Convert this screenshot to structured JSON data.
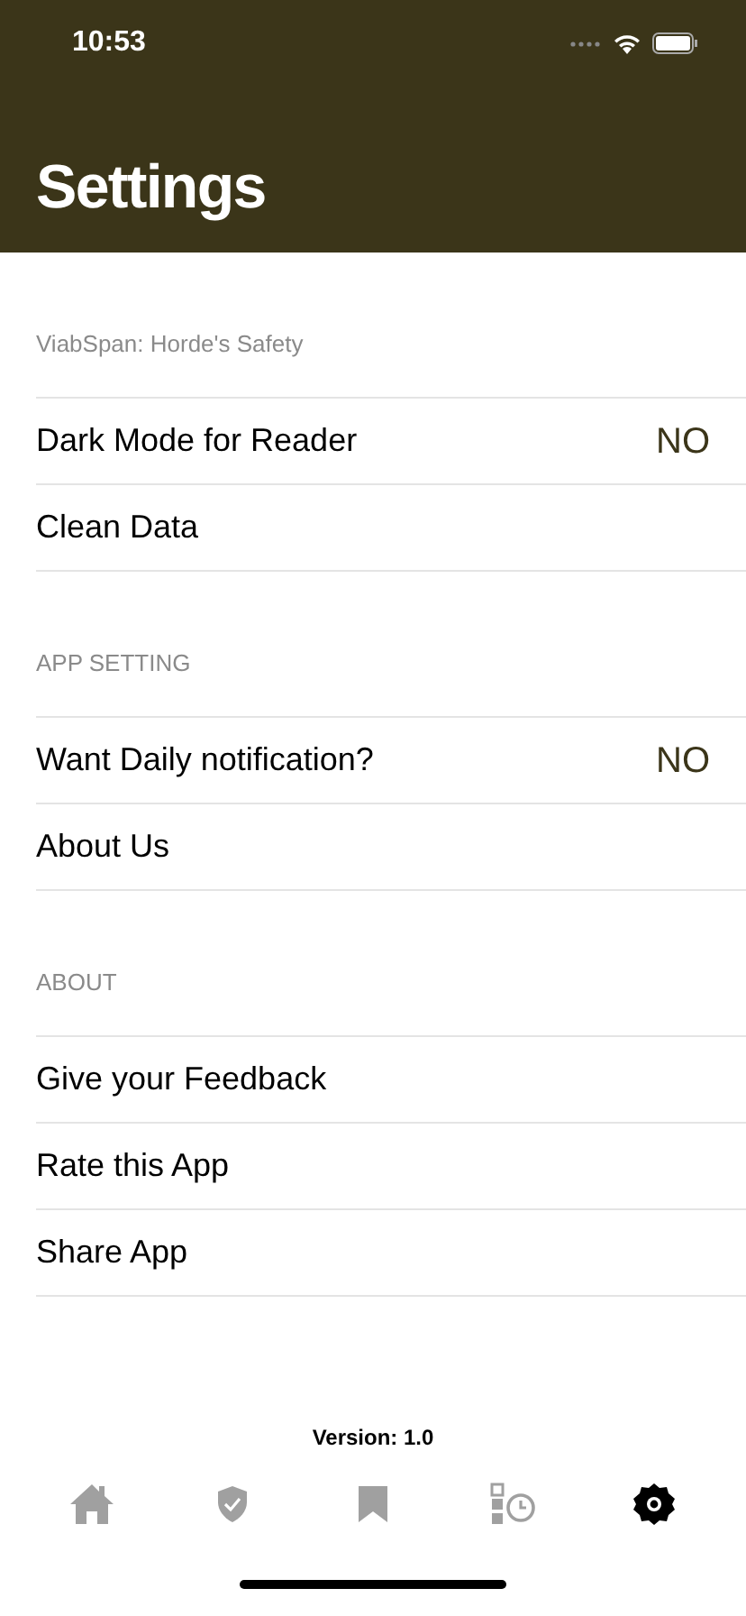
{
  "status_bar": {
    "time": "10:53"
  },
  "title": "Settings",
  "sections": [
    {
      "header": "ViabSpan: Horde's Safety",
      "rows": [
        {
          "kind": "value",
          "label": "Dark Mode for Reader",
          "value": "NO"
        },
        {
          "kind": "link",
          "label": "Clean Data"
        }
      ]
    },
    {
      "header": "APP SETTING",
      "rows": [
        {
          "kind": "value",
          "label": "Want Daily notification?",
          "value": "NO"
        },
        {
          "kind": "link",
          "label": "About Us"
        }
      ]
    },
    {
      "header": "ABOUT",
      "rows": [
        {
          "kind": "link",
          "label": "Give your Feedback"
        },
        {
          "kind": "link",
          "label": "Rate this App"
        },
        {
          "kind": "link",
          "label": "Share App"
        }
      ]
    }
  ],
  "version": "Version: 1.0",
  "tabs": [
    {
      "kind": "home",
      "selected": false
    },
    {
      "kind": "shield",
      "selected": false
    },
    {
      "kind": "bookmark",
      "selected": false
    },
    {
      "kind": "history",
      "selected": false
    },
    {
      "kind": "settings",
      "selected": true
    }
  ]
}
